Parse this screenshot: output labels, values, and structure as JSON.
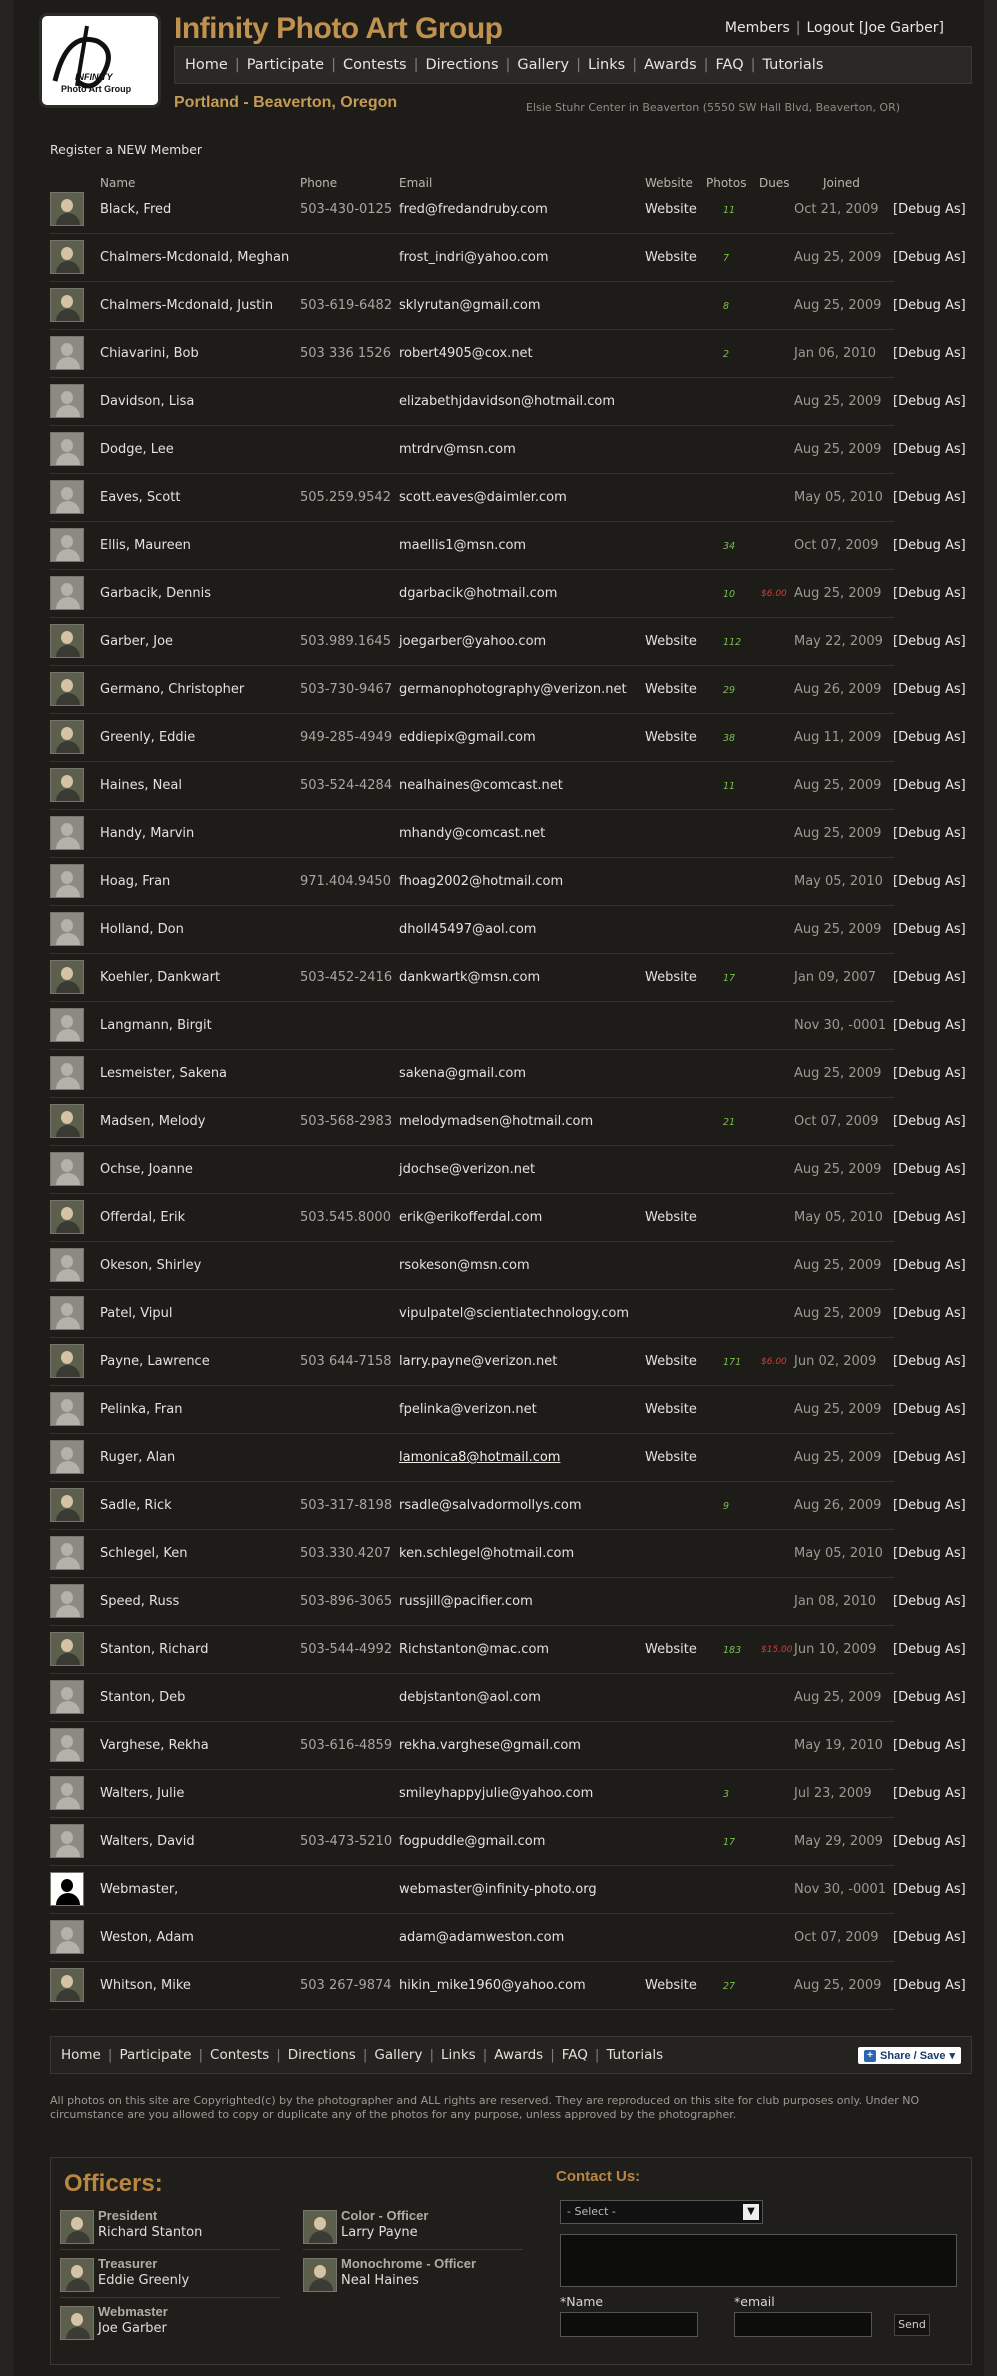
{
  "header": {
    "site_title": "Infinity Photo Art Group",
    "logo_text": "Photo Art Group",
    "logo_sub": "INFINITY",
    "members_link": "Members",
    "logout_link": "Logout",
    "user_name": "[Joe Garber]",
    "location": "Portland - Beaverton, Oregon",
    "address": "Elsie Stuhr Center in Beaverton (5550 SW Hall Blvd, Beaverton, OR)"
  },
  "nav": [
    "Home",
    "Participate",
    "Contests",
    "Directions",
    "Gallery",
    "Links",
    "Awards",
    "FAQ",
    "Tutorials"
  ],
  "register_link": "Register a NEW Member",
  "table": {
    "headers": {
      "name": "Name",
      "phone": "Phone",
      "email": "Email",
      "website": "Website",
      "photos": "Photos",
      "dues": "Dues",
      "joined": "Joined"
    },
    "debug_label": "[Debug As]",
    "rows": [
      {
        "avatar": "photo",
        "name": "Black, Fred",
        "phone": "503-430-0125",
        "email": "fred@fredandruby.com",
        "website": "Website",
        "photos": "11",
        "dues": "",
        "joined": "Oct 21, 2009"
      },
      {
        "avatar": "photo",
        "name": "Chalmers-Mcdonald, Meghan",
        "phone": "",
        "email": "frost_indri@yahoo.com",
        "website": "Website",
        "photos": "7",
        "dues": "",
        "joined": "Aug 25, 2009"
      },
      {
        "avatar": "photo",
        "name": "Chalmers-Mcdonald, Justin",
        "phone": "503-619-6482",
        "email": "sklyrutan@gmail.com",
        "website": "",
        "photos": "8",
        "dues": "",
        "joined": "Aug 25, 2009"
      },
      {
        "avatar": "default",
        "name": "Chiavarini, Bob",
        "phone": "503 336 1526",
        "email": "robert4905@cox.net",
        "website": "",
        "photos": "2",
        "dues": "",
        "joined": "Jan 06, 2010"
      },
      {
        "avatar": "default",
        "name": "Davidson, Lisa",
        "phone": "",
        "email": "elizabethjdavidson@hotmail.com",
        "website": "",
        "photos": "",
        "dues": "",
        "joined": "Aug 25, 2009"
      },
      {
        "avatar": "default",
        "name": "Dodge, Lee",
        "phone": "",
        "email": "mtrdrv@msn.com",
        "website": "",
        "photos": "",
        "dues": "",
        "joined": "Aug 25, 2009"
      },
      {
        "avatar": "default",
        "name": "Eaves, Scott",
        "phone": "505.259.9542",
        "email": "scott.eaves@daimler.com",
        "website": "",
        "photos": "",
        "dues": "",
        "joined": "May 05, 2010"
      },
      {
        "avatar": "default",
        "name": "Ellis, Maureen",
        "phone": "",
        "email": "maellis1@msn.com",
        "website": "",
        "photos": "34",
        "dues": "",
        "joined": "Oct 07, 2009"
      },
      {
        "avatar": "default",
        "name": "Garbacik, Dennis",
        "phone": "",
        "email": "dgarbacik@hotmail.com",
        "website": "",
        "photos": "10",
        "dues": "$6.00",
        "joined": "Aug 25, 2009"
      },
      {
        "avatar": "photo",
        "name": "Garber, Joe",
        "phone": "503.989.1645",
        "email": "joegarber@yahoo.com",
        "website": "Website",
        "photos": "112",
        "dues": "",
        "joined": "May 22, 2009"
      },
      {
        "avatar": "photo",
        "name": "Germano, Christopher",
        "phone": "503-730-9467",
        "email": "germanophotography@verizon.net",
        "website": "Website",
        "photos": "29",
        "dues": "",
        "joined": "Aug 26, 2009"
      },
      {
        "avatar": "photo",
        "name": "Greenly, Eddie",
        "phone": "949-285-4949",
        "email": "eddiepix@gmail.com",
        "website": "Website",
        "photos": "38",
        "dues": "",
        "joined": "Aug 11, 2009"
      },
      {
        "avatar": "photo",
        "name": "Haines, Neal",
        "phone": "503-524-4284",
        "email": "nealhaines@comcast.net",
        "website": "",
        "photos": "11",
        "dues": "",
        "joined": "Aug 25, 2009"
      },
      {
        "avatar": "default",
        "name": "Handy, Marvin",
        "phone": "",
        "email": "mhandy@comcast.net",
        "website": "",
        "photos": "",
        "dues": "",
        "joined": "Aug 25, 2009"
      },
      {
        "avatar": "default",
        "name": "Hoag, Fran",
        "phone": "971.404.9450",
        "email": "fhoag2002@hotmail.com",
        "website": "",
        "photos": "",
        "dues": "",
        "joined": "May 05, 2010"
      },
      {
        "avatar": "default",
        "name": "Holland, Don",
        "phone": "",
        "email": "dholl45497@aol.com",
        "website": "",
        "photos": "",
        "dues": "",
        "joined": "Aug 25, 2009"
      },
      {
        "avatar": "photo",
        "name": "Koehler, Dankwart",
        "phone": "503-452-2416",
        "email": "dankwartk@msn.com",
        "website": "Website",
        "photos": "17",
        "dues": "",
        "joined": "Jan 09, 2007"
      },
      {
        "avatar": "default",
        "name": "Langmann, Birgit",
        "phone": "",
        "email": "",
        "website": "",
        "photos": "",
        "dues": "",
        "joined": "Nov 30, -0001"
      },
      {
        "avatar": "default",
        "name": "Lesmeister, Sakena",
        "phone": "",
        "email": "sakena@gmail.com",
        "website": "",
        "photos": "",
        "dues": "",
        "joined": "Aug 25, 2009"
      },
      {
        "avatar": "photo",
        "name": "Madsen, Melody",
        "phone": "503-568-2983",
        "email": "melodymadsen@hotmail.com",
        "website": "",
        "photos": "21",
        "dues": "",
        "joined": "Oct 07, 2009"
      },
      {
        "avatar": "default",
        "name": "Ochse, Joanne",
        "phone": "",
        "email": "jdochse@verizon.net",
        "website": "",
        "photos": "",
        "dues": "",
        "joined": "Aug 25, 2009"
      },
      {
        "avatar": "photo",
        "name": "Offerdal, Erik",
        "phone": "503.545.8000",
        "email": "erik@erikofferdal.com",
        "website": "Website",
        "photos": "",
        "dues": "",
        "joined": "May 05, 2010"
      },
      {
        "avatar": "default",
        "name": "Okeson, Shirley",
        "phone": "",
        "email": "rsokeson@msn.com",
        "website": "",
        "photos": "",
        "dues": "",
        "joined": "Aug 25, 2009"
      },
      {
        "avatar": "default",
        "name": "Patel, Vipul",
        "phone": "",
        "email": "vipulpatel@scientiatechnology.com",
        "website": "",
        "photos": "",
        "dues": "",
        "joined": "Aug 25, 2009"
      },
      {
        "avatar": "photo",
        "name": "Payne, Lawrence",
        "phone": "503 644-7158",
        "email": "larry.payne@verizon.net",
        "website": "Website",
        "photos": "171",
        "dues": "$6.00",
        "joined": "Jun 02, 2009"
      },
      {
        "avatar": "default",
        "name": "Pelinka, Fran",
        "phone": "",
        "email": "fpelinka@verizon.net",
        "website": "Website",
        "photos": "",
        "dues": "",
        "joined": "Aug 25, 2009"
      },
      {
        "avatar": "default",
        "name": "Ruger, Alan",
        "phone": "",
        "email": "lamonica8@hotmail.com",
        "email_link": true,
        "website": "Website",
        "photos": "",
        "dues": "",
        "joined": "Aug 25, 2009"
      },
      {
        "avatar": "photo",
        "name": "Sadle, Rick",
        "phone": "503-317-8198",
        "email": "rsadle@salvadormollys.com",
        "website": "",
        "photos": "9",
        "dues": "",
        "joined": "Aug 26, 2009"
      },
      {
        "avatar": "default",
        "name": "Schlegel, Ken",
        "phone": "503.330.4207",
        "email": "ken.schlegel@hotmail.com",
        "website": "",
        "photos": "",
        "dues": "",
        "joined": "May 05, 2010"
      },
      {
        "avatar": "default",
        "name": "Speed, Russ",
        "phone": "503-896-3065",
        "email": "russjill@pacifier.com",
        "website": "",
        "photos": "",
        "dues": "",
        "joined": "Jan 08, 2010"
      },
      {
        "avatar": "photo",
        "name": "Stanton, Richard",
        "phone": "503-544-4992",
        "email": "Richstanton@mac.com",
        "website": "Website",
        "photos": "183",
        "dues": "$15.00",
        "joined": "Jun 10, 2009"
      },
      {
        "avatar": "default",
        "name": "Stanton, Deb",
        "phone": "",
        "email": "debjstanton@aol.com",
        "website": "",
        "photos": "",
        "dues": "",
        "joined": "Aug 25, 2009"
      },
      {
        "avatar": "default",
        "name": "Varghese, Rekha",
        "phone": "503-616-4859",
        "email": "rekha.varghese@gmail.com",
        "website": "",
        "photos": "",
        "dues": "",
        "joined": "May 19, 2010"
      },
      {
        "avatar": "default",
        "name": "Walters, Julie",
        "phone": "",
        "email": "smileyhappyjulie@yahoo.com",
        "website": "",
        "photos": "3",
        "dues": "",
        "joined": "Jul 23, 2009"
      },
      {
        "avatar": "default",
        "name": "Walters, David",
        "phone": "503-473-5210",
        "email": "fogpuddle@gmail.com",
        "website": "",
        "photos": "17",
        "dues": "",
        "joined": "May 29, 2009"
      },
      {
        "avatar": "silhouette",
        "name": "Webmaster,",
        "phone": "",
        "email": "webmaster@infinity-photo.org",
        "website": "",
        "photos": "",
        "dues": "",
        "joined": "Nov 30, -0001"
      },
      {
        "avatar": "default",
        "name": "Weston, Adam",
        "phone": "",
        "email": "adam@adamweston.com",
        "website": "",
        "photos": "",
        "dues": "",
        "joined": "Oct 07, 2009"
      },
      {
        "avatar": "photo",
        "name": "Whitson, Mike",
        "phone": "503 267-9874",
        "email": "hikin_mike1960@yahoo.com",
        "website": "Website",
        "photos": "27",
        "dues": "",
        "joined": "Aug 25, 2009"
      }
    ]
  },
  "footer_nav": [
    "Home",
    "Participate",
    "Contests",
    "Directions",
    "Gallery",
    "Links",
    "Awards",
    "FAQ",
    "Tutorials"
  ],
  "share_label": "Share / Save",
  "copyright": "All photos on this site are Copyrighted(c) by the photographer and ALL rights are reserved. They are reproduced on this site for club purposes only. Under NO circumstance are you allowed to copy or duplicate any of the photos for any purpose, unless approved by the photographer.",
  "officers": {
    "title": "Officers:",
    "list": [
      {
        "role": "President",
        "name": "Richard Stanton"
      },
      {
        "role": "Treasurer",
        "name": "Eddie Greenly"
      },
      {
        "role": "Webmaster",
        "name": "Joe Garber"
      },
      {
        "role": "Color - Officer",
        "name": "Larry Payne"
      },
      {
        "role": "Monochrome - Officer",
        "name": "Neal Haines"
      }
    ]
  },
  "contact": {
    "title": "Contact Us:",
    "select_value": "- Select -",
    "name_label": "*Name",
    "email_label": "*email",
    "send_label": "Send"
  },
  "colors": {
    "accent": "#c0914f",
    "photos_green": "#79c24a",
    "dues_red": "#d23f2e"
  }
}
